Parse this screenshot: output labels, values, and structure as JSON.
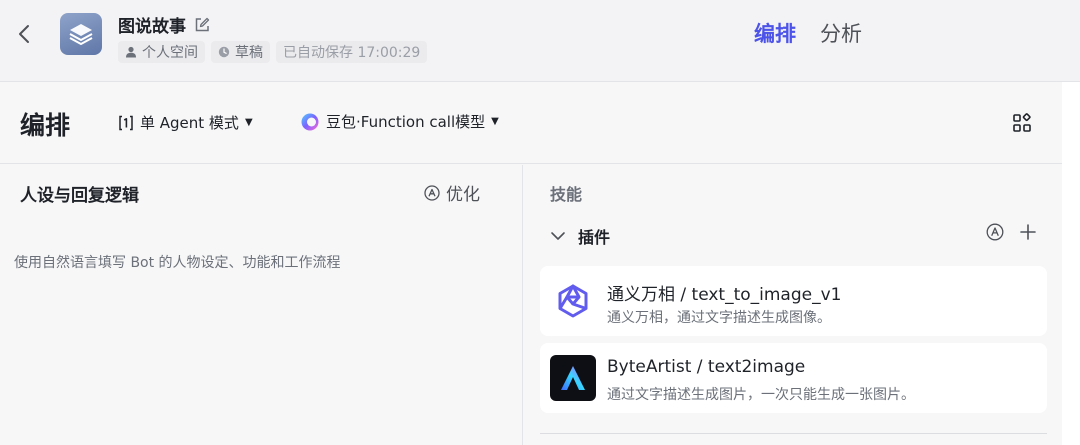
{
  "header": {
    "bot_name": "图说故事",
    "workspace": "个人空间",
    "status": "草稿",
    "autosave": "已自动保存 17:00:29",
    "tabs": [
      {
        "label": "编排",
        "active": true
      },
      {
        "label": "分析",
        "active": false
      }
    ]
  },
  "toolbar": {
    "title": "编排",
    "mode_label": "单 Agent 模式",
    "model_label": "豆包·Function call模型"
  },
  "persona": {
    "title": "人设与回复逻辑",
    "optimize_label": "优化",
    "placeholder": "使用自然语言填写 Bot 的人物设定、功能和工作流程"
  },
  "skills": {
    "title": "技能",
    "plugins": {
      "label": "插件",
      "items": [
        {
          "name": "通义万相 / text_to_image_v1",
          "description": "通义万相，通过文字描述生成图像。",
          "icon": "tongyi-wanxiang-logo"
        },
        {
          "name": "ByteArtist / text2image",
          "description": "通过文字描述生成图片，一次只能生成一张图片。",
          "icon": "byteartist-logo"
        }
      ]
    }
  },
  "colors": {
    "accent": "#4d53e8",
    "background": "#f7f7f8",
    "card": "#ffffff",
    "text_primary": "#1f2329",
    "text_secondary": "#6b7079"
  }
}
